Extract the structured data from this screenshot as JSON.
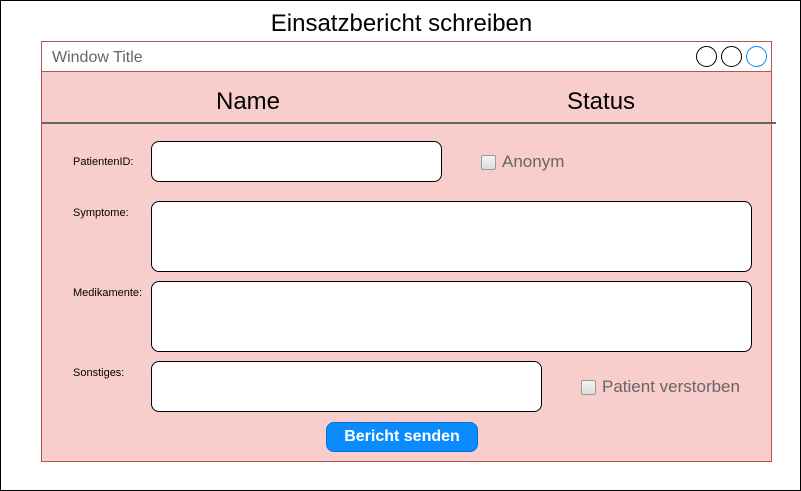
{
  "page": {
    "title": "Einsatzbericht schreiben"
  },
  "window": {
    "title": "Window Title",
    "controls": [
      {
        "name": "window-button-1-icon"
      },
      {
        "name": "window-button-2-icon"
      },
      {
        "name": "window-button-3-icon",
        "accent": "#008cff"
      }
    ]
  },
  "header": {
    "name_label": "Name",
    "status_label": "Status"
  },
  "form": {
    "patient_id": {
      "label": "PatientenID:",
      "value": ""
    },
    "anonym": {
      "label": "Anonym",
      "checked": false
    },
    "symptome": {
      "label": "Symptome:",
      "value": ""
    },
    "medikamente": {
      "label": "Medikamente:",
      "value": ""
    },
    "sonstiges": {
      "label": "Sonstiges:",
      "value": ""
    },
    "verstorben": {
      "label": "Patient verstorben",
      "checked": false
    },
    "submit_label": "Bericht senden"
  },
  "colors": {
    "window_bg": "#f8cecc",
    "window_border": "#b85450",
    "button_bg": "#0a8cff"
  }
}
